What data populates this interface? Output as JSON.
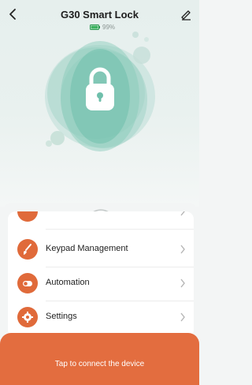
{
  "header": {
    "title": "G30 Smart Lock",
    "battery_percent": "99%",
    "battery_level": 0.99
  },
  "menu": {
    "items": [
      {
        "label": "Keypad Management",
        "icon": "brush-icon"
      },
      {
        "label": "Automation",
        "icon": "toggle-icon"
      },
      {
        "label": "Settings",
        "icon": "gear-icon"
      }
    ]
  },
  "footer": {
    "connect_label": "Tap to connect the device"
  },
  "colors": {
    "accent": "#e36d3f",
    "teal": "#5fc0ab"
  }
}
